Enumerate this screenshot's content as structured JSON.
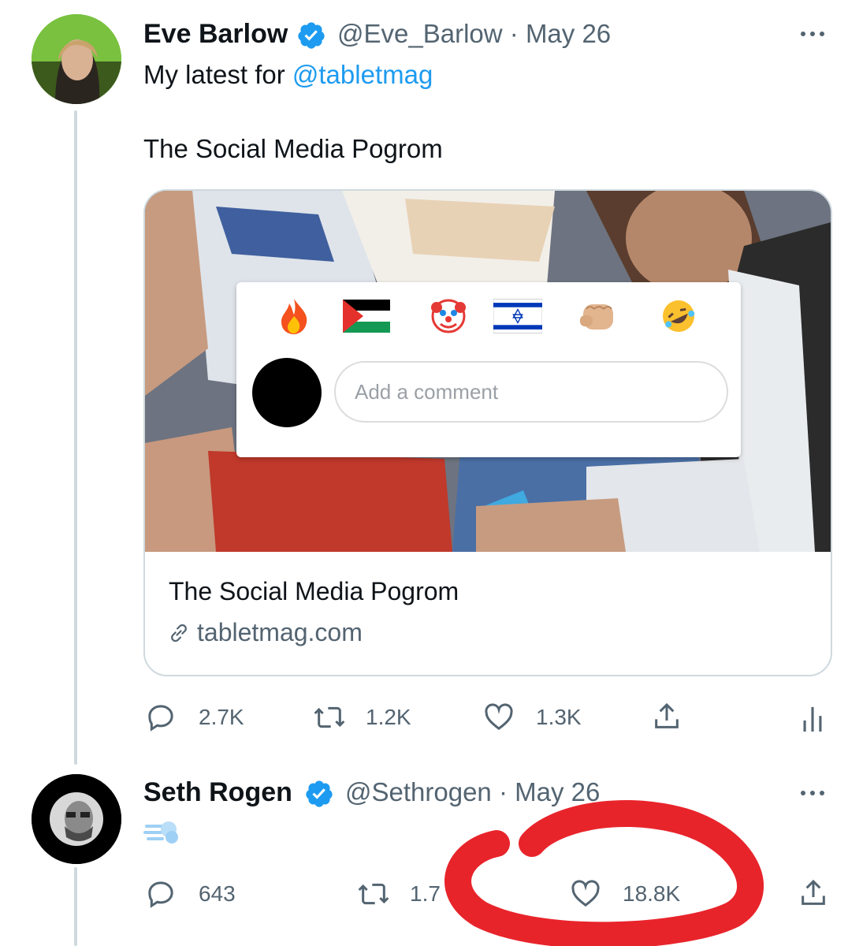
{
  "tweet1": {
    "author_name": "Eve Barlow",
    "handle": "@Eve_Barlow",
    "date": "May 26",
    "separator": "·",
    "text_prefix": "My latest for ",
    "mention": "@tabletmag",
    "text_line2": "The Social Media Pogrom",
    "card": {
      "comment_placeholder": "Add a comment",
      "emojis": [
        "fire-emoji",
        "palestine-flag-emoji",
        "clown-emoji",
        "israel-flag-emoji",
        "fist-emoji",
        "rofl-emoji"
      ],
      "title": "The Social Media Pogrom",
      "domain": "tabletmag.com"
    },
    "actions": {
      "replies": "2.7K",
      "retweets": "1.2K",
      "likes": "1.3K"
    }
  },
  "tweet2": {
    "author_name": "Seth Rogen",
    "handle": "@Sethrogen",
    "date": "May 26",
    "separator": "·",
    "body_emoji": "dash-emoji",
    "actions": {
      "replies": "643",
      "retweets": "1.7",
      "likes": "18.8K"
    }
  },
  "annotation": {
    "color": "#e8242b",
    "shape": "red-marker-circle"
  },
  "colors": {
    "link": "#1d9bf0",
    "verified": "#1d9bf0",
    "muted": "#536471"
  }
}
